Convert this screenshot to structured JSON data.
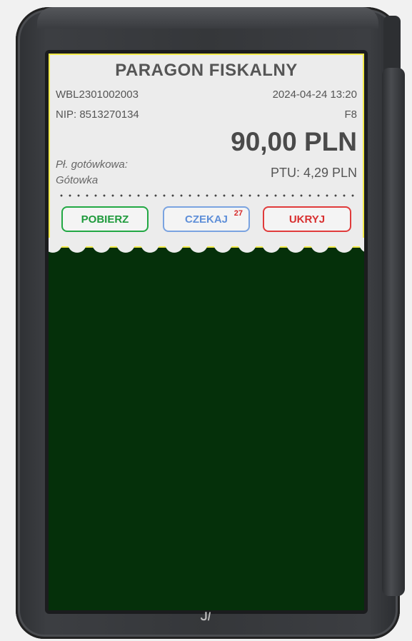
{
  "receipt": {
    "title": "PARAGON FISKALNY",
    "id": "WBL2301002003",
    "datetime": "2024-04-24 13:20",
    "nip": "NIP: 8513270134",
    "code": "F8",
    "amount": "90,00 PLN",
    "payment_label": "Pł. gotówkowa:",
    "payment_value": "Gótowka",
    "ptu": "PTU: 4,29 PLN"
  },
  "actions": {
    "collect_label": "POBIERZ",
    "wait_label": "CZEKAJ",
    "wait_count": "27",
    "hide_label": "UKRYJ"
  },
  "device": {
    "logo": "ᒍ/"
  },
  "colors": {
    "screen_bg": "#05300a",
    "receipt_bg": "#ececec",
    "receipt_border": "#f2ea4a",
    "collect": "#22a844",
    "wait": "#7aa3e0",
    "hide": "#e03b3b"
  }
}
